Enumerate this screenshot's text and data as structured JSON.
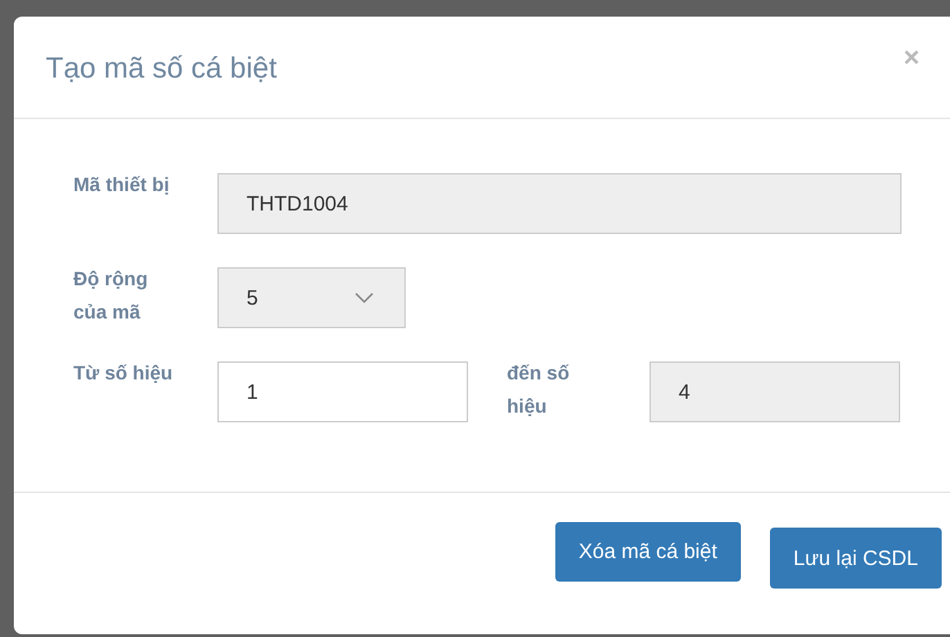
{
  "dialog": {
    "title": "Tạo mã số cá biệt",
    "close": "×"
  },
  "rows": [
    {
      "fields": [
        {
          "label": "Mã thiết bị",
          "kind": "input",
          "value": "THTD1004",
          "disabled": true
        }
      ]
    },
    {
      "fields": [
        {
          "label": "Độ rộng của mã",
          "kind": "select",
          "value": "5",
          "disabled": true
        }
      ]
    },
    {
      "fields": [
        {
          "label": "Từ số hiệu",
          "kind": "input",
          "value": "1",
          "disabled": false
        },
        {
          "label": "đến số hiệu",
          "kind": "input",
          "value": "4",
          "disabled": true
        }
      ]
    }
  ],
  "buttons": [
    "Xóa mã cá biệt",
    "Lưu lại CSDL"
  ]
}
